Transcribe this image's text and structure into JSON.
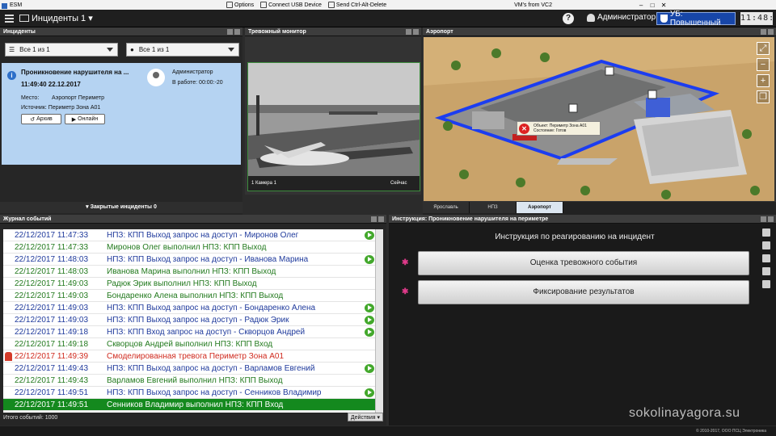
{
  "os": {
    "app_name": "ESM",
    "vm_menu": [
      "Options",
      "Connect USB Device",
      "Send Ctrl-Alt-Delete"
    ],
    "vm_title": "VM's from VC2",
    "window_buttons": [
      "–",
      "□",
      "✕"
    ]
  },
  "appbar": {
    "title": "Инциденты 1",
    "help": "?",
    "user": "Администратор",
    "security_level": "УБ: Повышенный",
    "clock": "11:48:27"
  },
  "incidents": {
    "header": "Инциденты",
    "filter1": "Все  1 из 1",
    "filter2": "Все  1 из 1",
    "card": {
      "title": "Проникновение нарушителя на ...",
      "time": "11:49:40 22.12.2017",
      "user": "Администратор",
      "state": "В работе: 00:00:-20",
      "place_label": "Место:",
      "place": "Аэропорт Периметр",
      "source_label": "Источник:",
      "source": "Периметр Зона А01",
      "archive_btn": "Архив",
      "online_btn": "Онлайн"
    },
    "closed_label": "Закрытые инциденты",
    "closed_count": "0"
  },
  "alarm_monitor": {
    "header": "Тревожный монитор",
    "cam_caption": "1 Камера 1",
    "cam_right": "Сейчас"
  },
  "airport": {
    "header": "Аэропорт",
    "tooltip_object": "Объект: Периметр Зона А01",
    "tooltip_state": "Состояние: Готов",
    "tabs": [
      "Ярославль",
      "НПЗ",
      "Аэропорт"
    ],
    "active_tab": "Аэропорт",
    "zoom_controls": [
      "⤢",
      "−",
      "+",
      "❐"
    ]
  },
  "journal": {
    "header": "Журнал событий",
    "rows": [
      {
        "dt": "22/12/2017 11:47:33",
        "msg": "НПЗ: КПП Выход запрос на доступ - Миронов Олег",
        "color": "blue",
        "action": true
      },
      {
        "dt": "22/12/2017 11:47:33",
        "msg": "Миронов Олег выполнил НПЗ: КПП Выход",
        "color": "green",
        "action": false
      },
      {
        "dt": "22/12/2017 11:48:03",
        "msg": "НПЗ: КПП Выход запрос на доступ - Иванова Марина",
        "color": "blue",
        "action": true
      },
      {
        "dt": "22/12/2017 11:48:03",
        "msg": "Иванова Марина выполнил НПЗ: КПП Выход",
        "color": "green",
        "action": false
      },
      {
        "dt": "22/12/2017 11:49:03",
        "msg": "Радюк Эрик выполнил НПЗ: КПП Выход",
        "color": "green",
        "action": false
      },
      {
        "dt": "22/12/2017 11:49:03",
        "msg": "Бондаренко Алена выполнил НПЗ: КПП Выход",
        "color": "green",
        "action": false
      },
      {
        "dt": "22/12/2017 11:49:03",
        "msg": "НПЗ: КПП Выход запрос на доступ - Бондаренко Алена",
        "color": "blue",
        "action": true
      },
      {
        "dt": "22/12/2017 11:49:03",
        "msg": "НПЗ: КПП Выход запрос на доступ - Радюк Эрик",
        "color": "blue",
        "action": true
      },
      {
        "dt": "22/12/2017 11:49:18",
        "msg": "НПЗ: КПП Вход запрос на доступ - Скворцов Андрей",
        "color": "blue",
        "action": true
      },
      {
        "dt": "22/12/2017 11:49:18",
        "msg": "Скворцов Андрей выполнил НПЗ: КПП Вход",
        "color": "green",
        "action": false
      },
      {
        "dt": "22/12/2017 11:49:39",
        "msg": "Смоделированная тревога Периметр Зона А01",
        "color": "red",
        "action": false,
        "alarm": true
      },
      {
        "dt": "22/12/2017 11:49:43",
        "msg": "НПЗ: КПП Выход запрос на доступ - Варламов Евгений",
        "color": "blue",
        "action": true
      },
      {
        "dt": "22/12/2017 11:49:43",
        "msg": "Варламов Евгений выполнил НПЗ: КПП Выход",
        "color": "green",
        "action": false
      },
      {
        "dt": "22/12/2017 11:49:51",
        "msg": "НПЗ: КПП Выход запрос на доступ - Сенников Владимир",
        "color": "blue",
        "action": true
      },
      {
        "dt": "22/12/2017 11:49:51",
        "msg": "Сенников Владимир выполнил НПЗ: КПП Вход",
        "color": "green",
        "action": false,
        "selected": true
      }
    ],
    "total_label": "Итого событий: 1000",
    "actions_btn": "Действия"
  },
  "instruction": {
    "header": "Инструкция: Проникновение нарушителя на периметре",
    "title": "Инструкция по реагированию на инцидент",
    "steps": [
      "Оценка тревожного события",
      "Фиксирование результатов"
    ]
  },
  "footer": {
    "copyright": "© 2010-2017, ООО ПСЦ Электроника",
    "watermark": "sokolinayagora.su"
  },
  "colors": {
    "accent": "#1746a8",
    "selected_row": "#14891e",
    "alarm": "#d02b1f",
    "incident_card": "#b5d3f2"
  }
}
